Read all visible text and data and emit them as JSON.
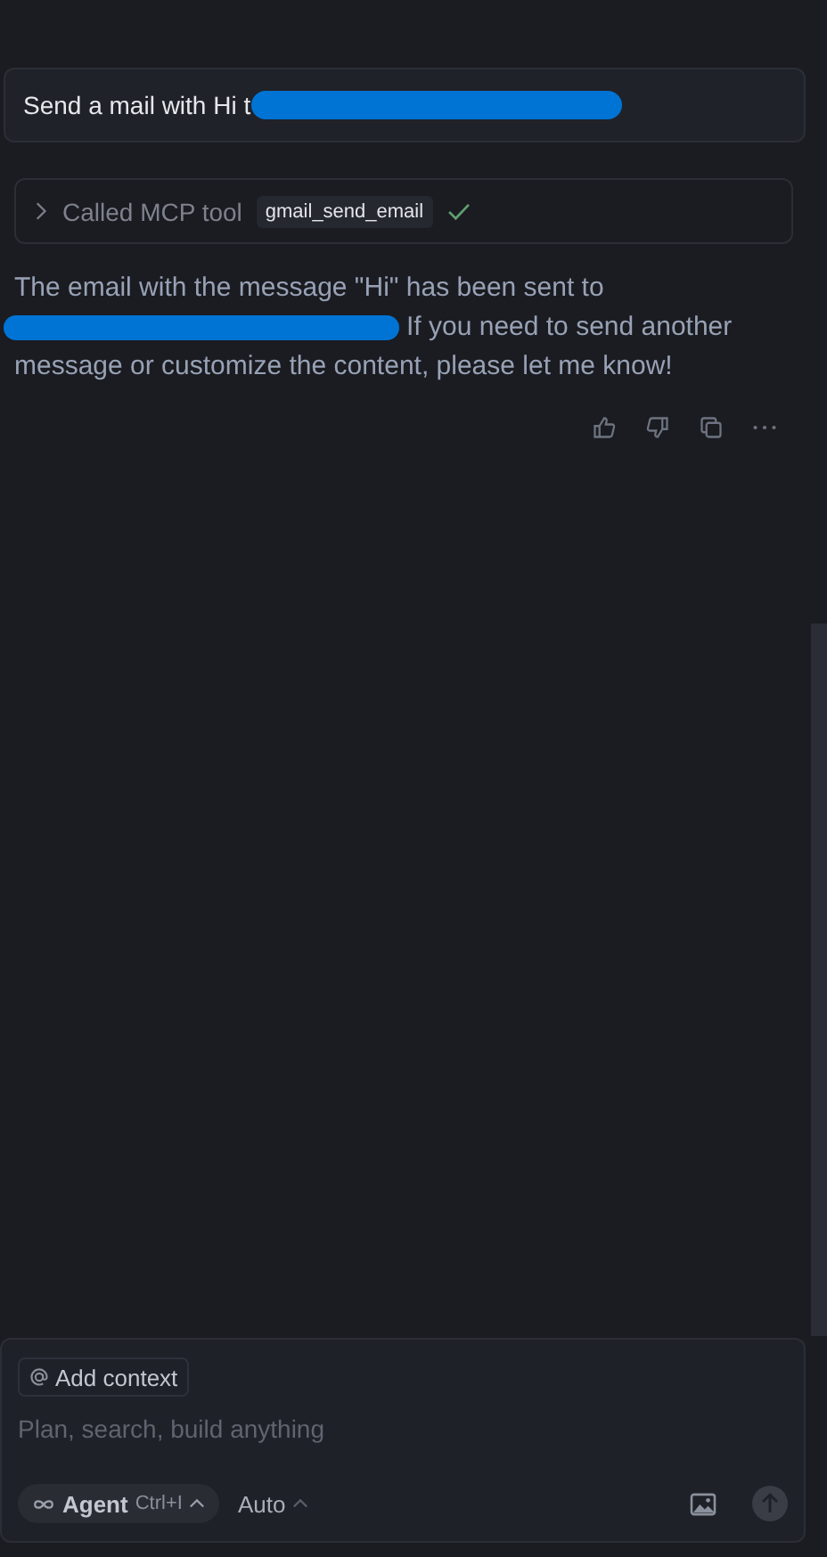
{
  "user_message": {
    "text": "Send a mail with Hi t",
    "redacted": true
  },
  "tool_call": {
    "expanded": false,
    "label": "Called MCP tool",
    "tool": "gmail_send_email",
    "success": true
  },
  "response": {
    "before": "The email with the message \"Hi\" has been sent to",
    "redacted": true,
    "after_first": "If you need to send another",
    "after_rest": "message or customize the content, please let me know!"
  },
  "composer": {
    "context_button": "Add context",
    "placeholder": "Plan, search, build anything",
    "mode": "Agent",
    "shortcut": "Ctrl+I",
    "model": "Auto"
  }
}
